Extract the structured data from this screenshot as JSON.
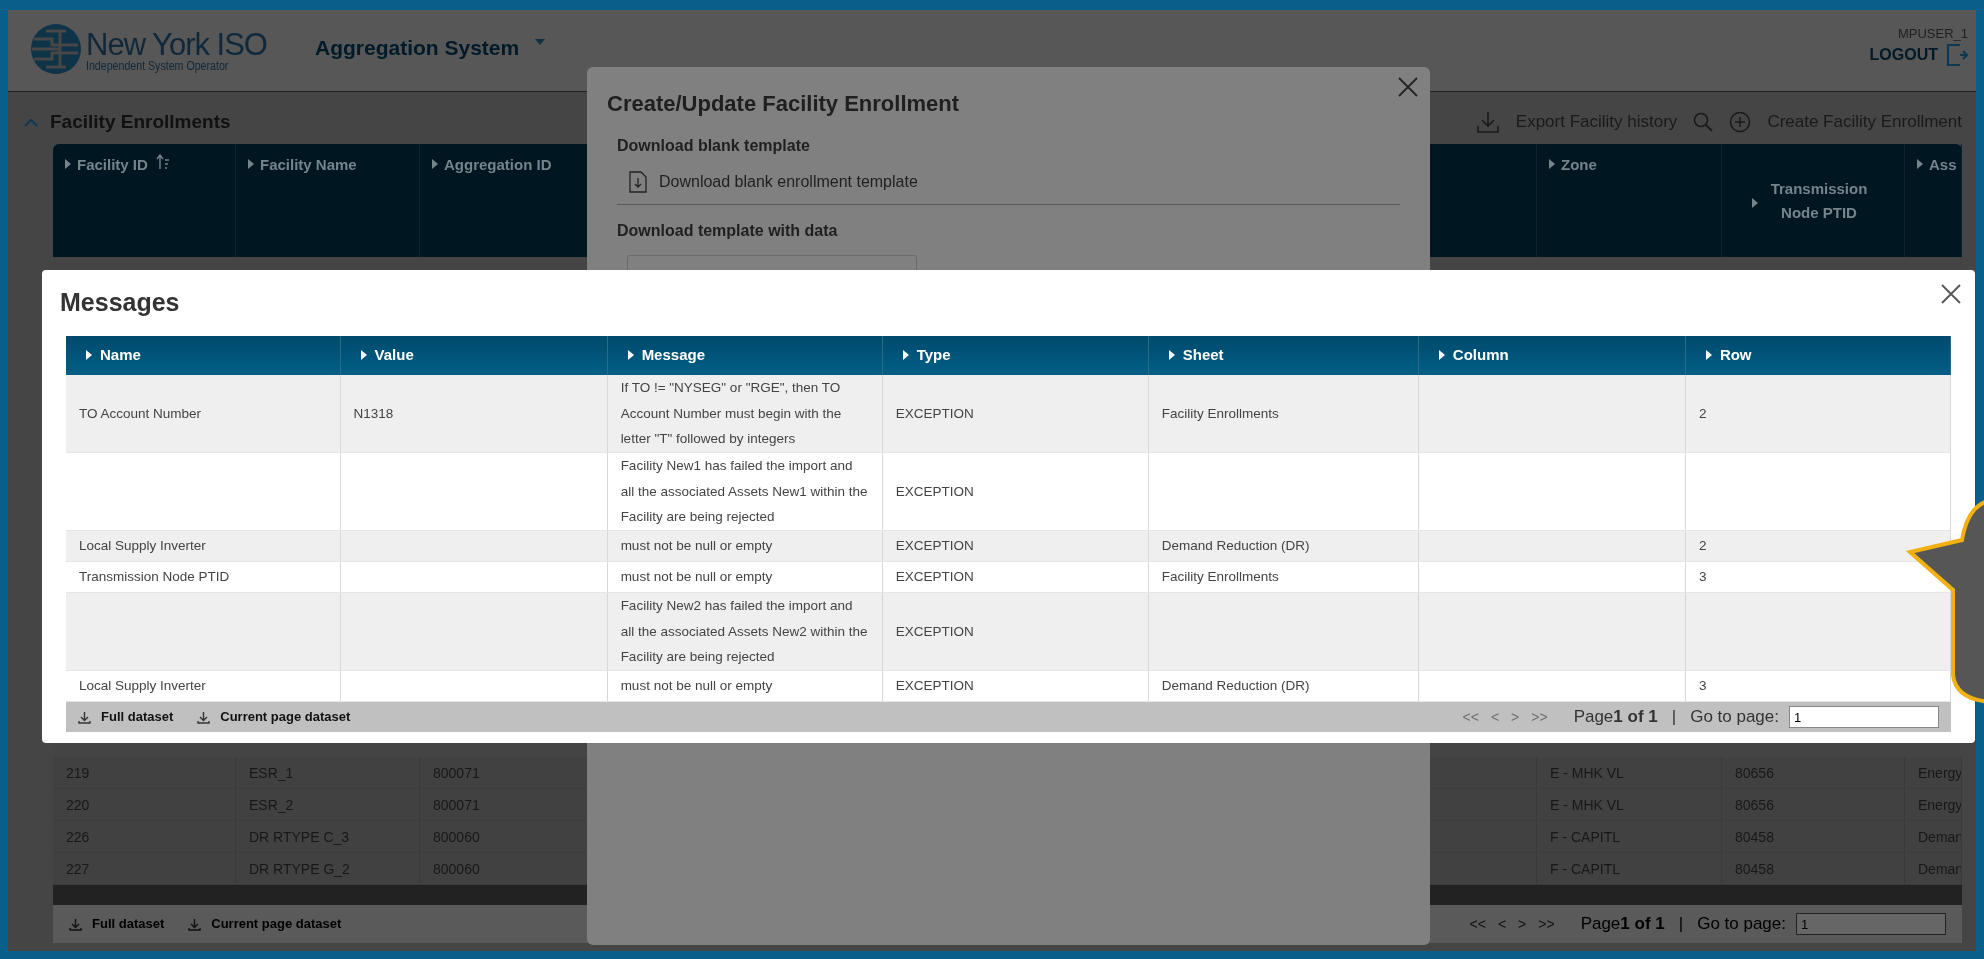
{
  "header": {
    "logo_title": "New York ISO",
    "logo_subtitle": "Independent System Operator",
    "app_menu": "Aggregation System",
    "user": "MPUSER_1",
    "logout": "LOGOUT"
  },
  "page": {
    "title": "Facility Enrollments",
    "expanded": true,
    "actions": [
      {
        "kind": "export",
        "label": "Export Facility history"
      },
      {
        "kind": "search"
      },
      {
        "kind": "create",
        "label": "Create Facility Enrollment"
      }
    ],
    "table": {
      "columns": [
        {
          "label": "Facility ID",
          "sorted": true
        },
        {
          "label": "Facility Name",
          "sorted": false
        },
        {
          "label": "Aggregation ID",
          "sorted": false
        }
      ],
      "right_columns": [
        {
          "label": "Zone"
        },
        {
          "label": "Transmission Node PTID"
        },
        {
          "label": "Ass"
        }
      ],
      "rows": [
        {
          "cells": [
            "219",
            "ESR_1",
            "800071"
          ],
          "right_cells": [
            "E - MHK VL",
            "80656",
            "Energy"
          ]
        },
        {
          "cells": [
            "220",
            "ESR_2",
            "800071"
          ],
          "right_cells": [
            "E - MHK VL",
            "80656",
            "Energy"
          ]
        },
        {
          "cells": [
            "226",
            "DR RTYPE C_3",
            "800060"
          ],
          "right_cells": [
            "F - CAPITL",
            "80458",
            "Deman"
          ]
        },
        {
          "cells": [
            "227",
            "DR RTYPE G_2",
            "800060"
          ],
          "right_cells": [
            "F - CAPITL",
            "80458",
            "Deman"
          ]
        }
      ]
    },
    "footer": {
      "downloads": [
        "Full dataset",
        "Current page dataset"
      ],
      "nav": [
        "<<",
        "<",
        ">",
        ">>"
      ],
      "page": "Page**1 of 1**",
      "separator": "|",
      "goto_label": "Go to page:",
      "goto_value": "1"
    }
  },
  "enrollment_dialog": {
    "title": "Create/Update Facility Enrollment",
    "blank_heading": "Download blank template",
    "blank_link": "Download blank enrollment template",
    "data_heading": "Download template with data"
  },
  "messages_dialog": {
    "title": "Messages",
    "columns": [
      "Name",
      "Value",
      "Message",
      "Type",
      "Sheet",
      "Column",
      "Row"
    ],
    "rows": [
      [
        "TO Account Number",
        "N1318",
        "If TO != \"NYSEG\" or \"RGE\", then TO Account Number must begin with the letter \"T\" followed by integers",
        "EXCEPTION",
        "Facility Enrollments",
        null,
        "2"
      ],
      [
        null,
        null,
        "Facility New1 has failed the import and all the associated Assets New1 within the Facility are being rejected",
        "EXCEPTION",
        null,
        null,
        null
      ],
      [
        "Local Supply Inverter",
        null,
        "must not be null or empty",
        "EXCEPTION",
        "Demand Reduction (DR)",
        null,
        "2"
      ],
      [
        "Transmission Node PTID",
        null,
        "must not be null or empty",
        "EXCEPTION",
        "Facility Enrollments",
        null,
        "3"
      ],
      [
        null,
        null,
        "Facility New2 has failed the import and all the associated Assets New2 within the Facility are being rejected",
        "EXCEPTION",
        null,
        null,
        null
      ],
      [
        "Local Supply Inverter",
        null,
        "must not be null or empty",
        "EXCEPTION",
        "Demand Reduction (DR)",
        null,
        "3"
      ]
    ],
    "footer": {
      "downloads": [
        "Full dataset",
        "Current page dataset"
      ],
      "nav": [
        "<<",
        "<",
        ">",
        ">>"
      ],
      "page": "Page**1 of 1**",
      "separator": "|",
      "goto_label": "Go to page:",
      "goto_value": "1"
    }
  }
}
